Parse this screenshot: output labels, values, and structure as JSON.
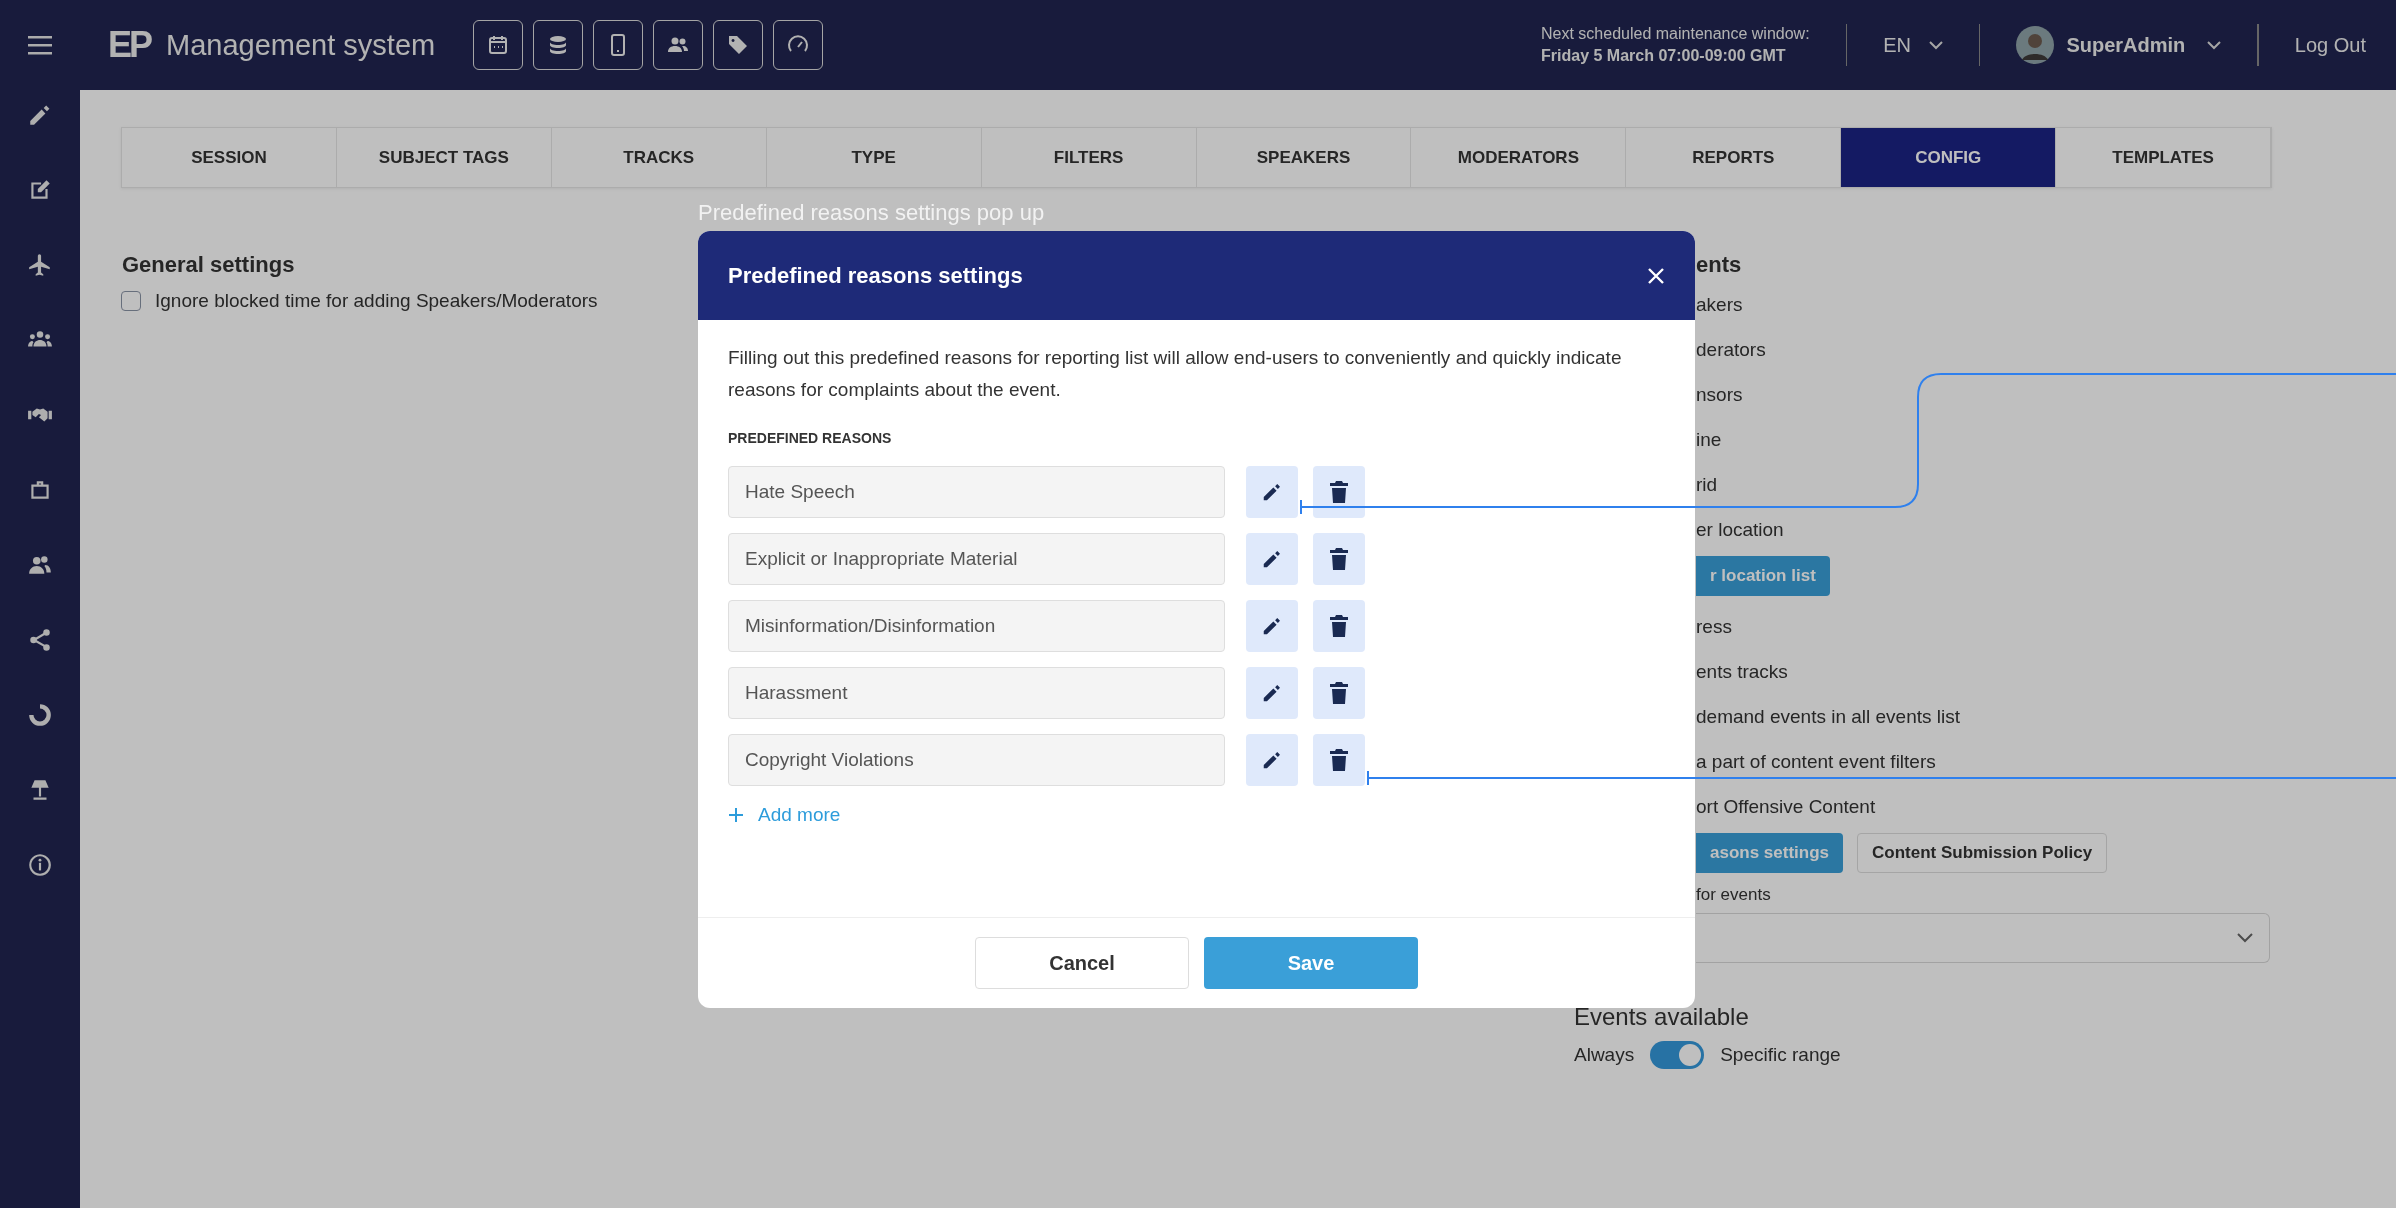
{
  "app_bar": {
    "logo": "EP",
    "title": "Management system",
    "maintenance_label": "Next scheduled maintenance window:",
    "maintenance_value": "Friday 5 March 07:00-09:00 GMT",
    "language": "EN",
    "user": "SuperAdmin",
    "logout": "Log Out"
  },
  "tabs": [
    {
      "label": "SESSION",
      "selected": false
    },
    {
      "label": "SUBJECT TAGS",
      "selected": false
    },
    {
      "label": "TRACKS",
      "selected": false
    },
    {
      "label": "TYPE",
      "selected": false
    },
    {
      "label": "FILTERS",
      "selected": false
    },
    {
      "label": "SPEAKERS",
      "selected": false
    },
    {
      "label": "MODERATORS",
      "selected": false
    },
    {
      "label": "REPORTS",
      "selected": false
    },
    {
      "label": "CONFIG",
      "selected": true
    },
    {
      "label": "TEMPLATES",
      "selected": false
    }
  ],
  "general_settings": {
    "title": "General settings",
    "options": [
      {
        "label": "Ignore blocked time for adding Speakers/Moderators",
        "checked": false
      }
    ]
  },
  "events_panel": {
    "heading": "ents",
    "items": [
      {
        "kind": "option",
        "label": "akers"
      },
      {
        "kind": "option",
        "label": "derators"
      },
      {
        "kind": "option",
        "label": "nsors"
      },
      {
        "kind": "option",
        "label": "ine"
      },
      {
        "kind": "option",
        "label": "rid"
      },
      {
        "kind": "option",
        "label": "er location"
      },
      {
        "kind": "buttons",
        "buttons": [
          {
            "label": "r location list",
            "primary": true
          }
        ]
      },
      {
        "kind": "option",
        "label": "ress"
      },
      {
        "kind": "option",
        "label": "ents tracks"
      },
      {
        "kind": "option",
        "label": "demand events in all events list"
      },
      {
        "kind": "option",
        "label": "a part of content event filters"
      },
      {
        "kind": "option",
        "label": "ort Offensive Content"
      },
      {
        "kind": "buttons",
        "buttons": [
          {
            "label": "asons settings",
            "primary": true
          },
          {
            "label": "Content Submission Policy",
            "primary": false
          }
        ]
      },
      {
        "kind": "select",
        "label": "for events"
      }
    ]
  },
  "events_available": {
    "title": "Events available",
    "off_label": "Always",
    "on_label": "Specific range",
    "on": true
  },
  "annotation_label": "Predefined reasons settings pop up",
  "modal": {
    "title": "Predefined reasons settings",
    "description": "Filling out this predefined reasons for reporting list will allow end-users to conveniently and quickly indicate reasons for complaints about the event.",
    "section_label": "PREDEFINED REASONS",
    "reasons": [
      "Hate Speech",
      "Explicit or Inappropriate Material",
      "Misinformation/Disinformation",
      "Harassment",
      "Copyright Violations"
    ],
    "add_label": "Add more",
    "cancel": "Cancel",
    "save": "Save"
  }
}
